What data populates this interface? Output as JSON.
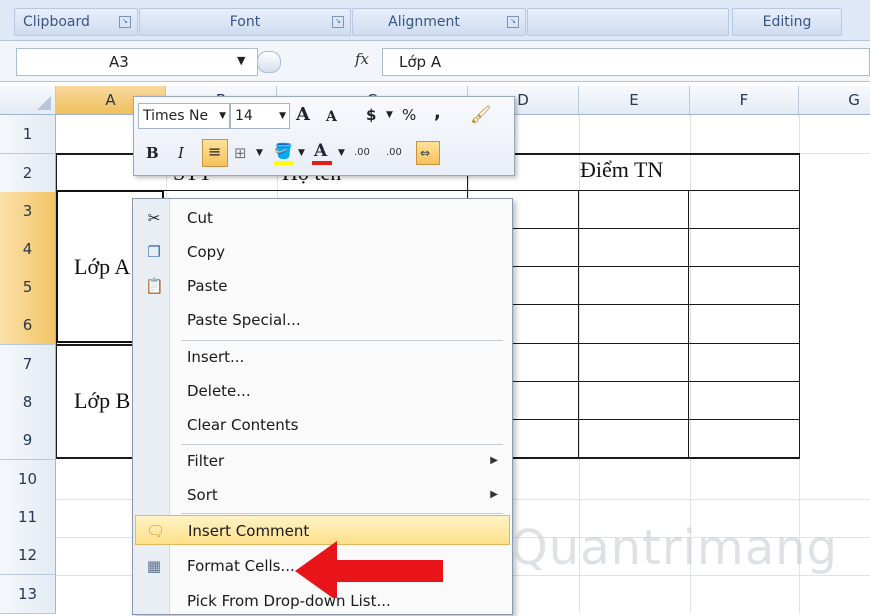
{
  "ribbon": {
    "groups": [
      {
        "label": "Clipboard"
      },
      {
        "label": "Font"
      },
      {
        "label": "Alignment"
      },
      {
        "label": ""
      },
      {
        "label": "Editing"
      }
    ]
  },
  "formula_bar": {
    "name_box": "A3",
    "fx_label": "fx",
    "formula": "Lớp A"
  },
  "grid": {
    "columns": [
      "A",
      "B",
      "C",
      "D",
      "E",
      "F",
      "G"
    ],
    "rows": [
      "1",
      "2",
      "3",
      "4",
      "5",
      "6",
      "7",
      "8",
      "9",
      "10",
      "11",
      "12",
      "13"
    ],
    "cells": {
      "b2": "STT",
      "c2": "Họ tên",
      "e2": "Điểm TN",
      "a4": "Lớp A",
      "a8": "Lớp B"
    }
  },
  "mini_toolbar": {
    "font_name": "Times Ne",
    "font_size": "14",
    "grow_font": "A",
    "shrink_font": "A",
    "currency": "$",
    "percent": "%",
    "comma": ",",
    "bold": "B",
    "italic": "I",
    "font_color_glyph": "A",
    "inc_decimal": ".00",
    "dec_decimal": ".00"
  },
  "context_menu": {
    "items": [
      {
        "label": "Cut",
        "icon": "scissors-icon"
      },
      {
        "label": "Copy",
        "icon": "copy-icon"
      },
      {
        "label": "Paste",
        "icon": "paste-icon"
      },
      {
        "label": "Paste Special..."
      },
      {
        "label": "Insert..."
      },
      {
        "label": "Delete..."
      },
      {
        "label": "Clear Contents"
      },
      {
        "label": "Filter",
        "submenu": true
      },
      {
        "label": "Sort",
        "submenu": true
      },
      {
        "label": "Insert Comment",
        "icon": "comment-icon",
        "highlighted": true
      },
      {
        "label": "Format Cells...",
        "icon": "format-cells-icon"
      },
      {
        "label": "Pick From Drop-down List..."
      }
    ]
  },
  "watermark": "Quantrimang",
  "colors": {
    "arrow": "#e8141a",
    "selected_header": "#f3c466",
    "menu_highlight": "#fde08a"
  }
}
